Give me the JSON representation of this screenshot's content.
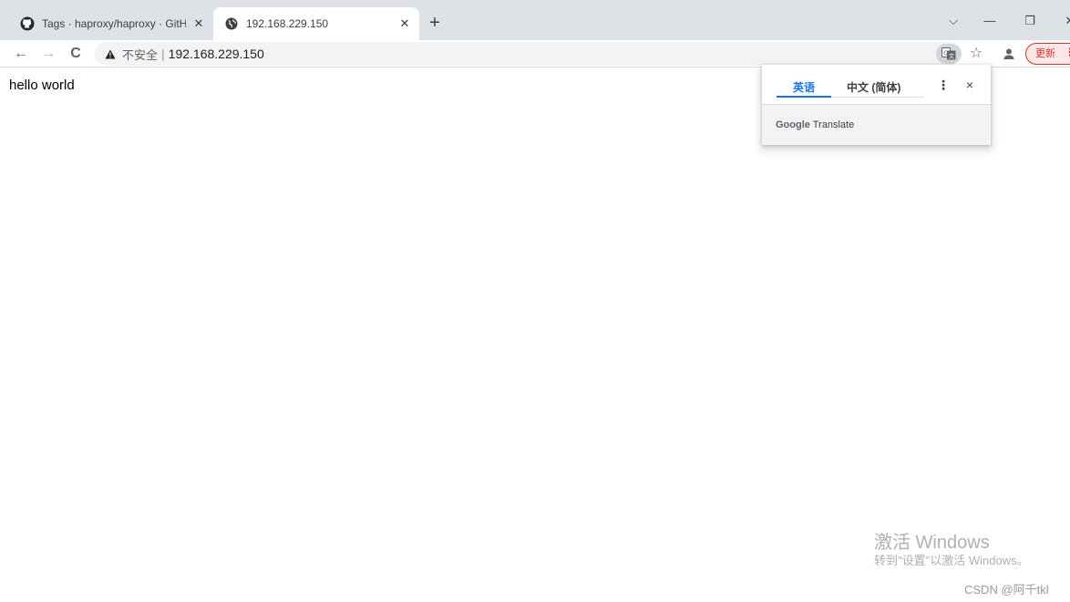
{
  "browser": {
    "tabs": [
      {
        "title": "Tags · haproxy/haproxy · GitHub",
        "icon": "github-icon",
        "active": false
      },
      {
        "title": "192.168.229.150",
        "icon": "globe-icon",
        "active": true
      }
    ],
    "new_tab_label": "+",
    "window_controls": {
      "dropdown": "⌵",
      "minimize": "—",
      "restore": "❐",
      "close": "✕"
    },
    "nav": {
      "back": "←",
      "forward": "→",
      "reload": "C"
    },
    "address_bar": {
      "security_label": "不安全",
      "separator": "|",
      "url": "192.168.229.150"
    },
    "update_button": {
      "label": "更新",
      "menu": "⋮"
    },
    "accent": "#1a73e8"
  },
  "page": {
    "body_text": "hello world"
  },
  "translate_popup": {
    "tabs": [
      "英语",
      "中文 (简体)"
    ],
    "active_tab": "英语",
    "menu": "⋮",
    "close": "×",
    "brand": "Google",
    "brand_suffix": "Translate"
  },
  "overlay": {
    "activate_title": "激活 Windows",
    "activate_sub": "转到\"设置\"以激活 Windows。",
    "watermark": "CSDN @阿千tkl"
  }
}
